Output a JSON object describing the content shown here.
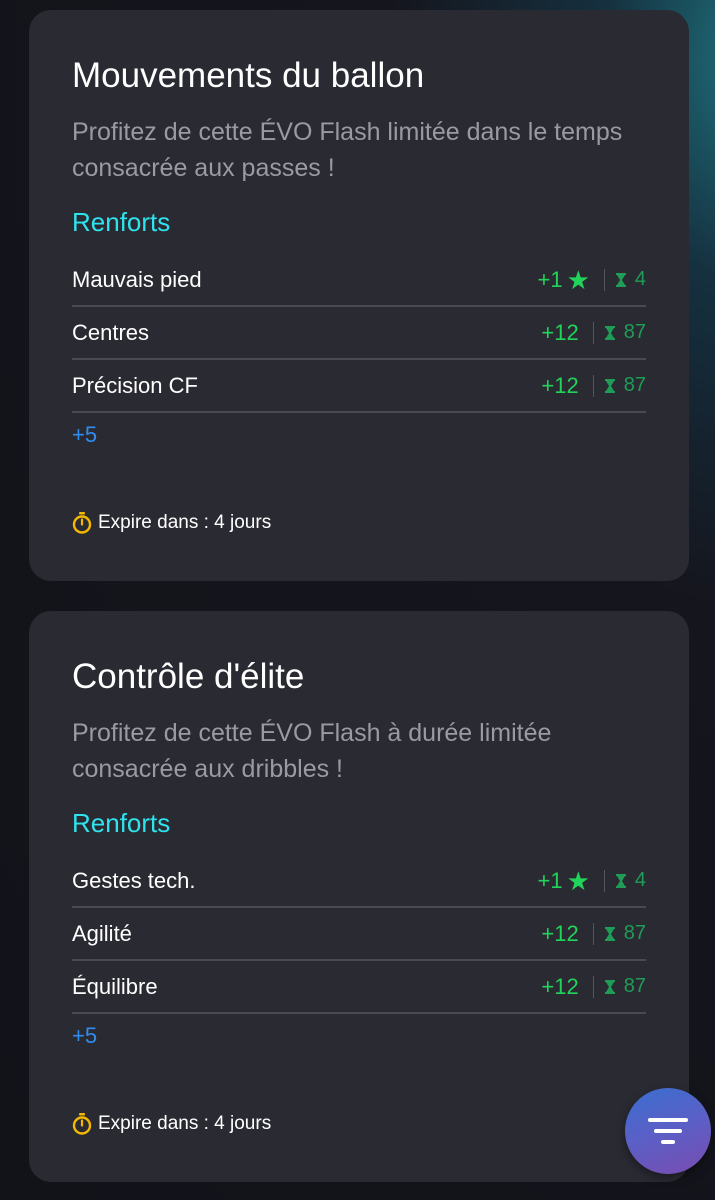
{
  "cards": [
    {
      "title": "Mouvements du ballon",
      "description": "Profitez de cette ÉVO Flash limitée dans le temps consacrée aux passes !",
      "section_title": "Renforts",
      "stats": [
        {
          "name": "Mauvais pied",
          "boost": "+1",
          "star": true,
          "value": "4"
        },
        {
          "name": "Centres",
          "boost": "+12",
          "star": false,
          "value": "87"
        },
        {
          "name": "Précision CF",
          "boost": "+12",
          "star": false,
          "value": "87"
        }
      ],
      "more_label": "+5",
      "expire_text": "Expire dans : 4 jours"
    },
    {
      "title": "Contrôle d'élite",
      "description": "Profitez de cette ÉVO Flash à durée limitée consacrée aux dribbles !",
      "section_title": "Renforts",
      "stats": [
        {
          "name": "Gestes tech.",
          "boost": "+1",
          "star": true,
          "value": "4"
        },
        {
          "name": "Agilité",
          "boost": "+12",
          "star": false,
          "value": "87"
        },
        {
          "name": "Équilibre",
          "boost": "+12",
          "star": false,
          "value": "87"
        }
      ],
      "more_label": "+5",
      "expire_text": "Expire dans : 4 jours"
    }
  ],
  "icons": {
    "star": "star-icon",
    "max_level": "hourglass-icon",
    "timer": "stopwatch-icon",
    "filter_fab": "filter-icon"
  },
  "colors": {
    "accent_cyan": "#2fe3ee",
    "boost_green": "#22d35a",
    "link_blue": "#2f8df0",
    "timer_yellow": "#f5b800"
  }
}
